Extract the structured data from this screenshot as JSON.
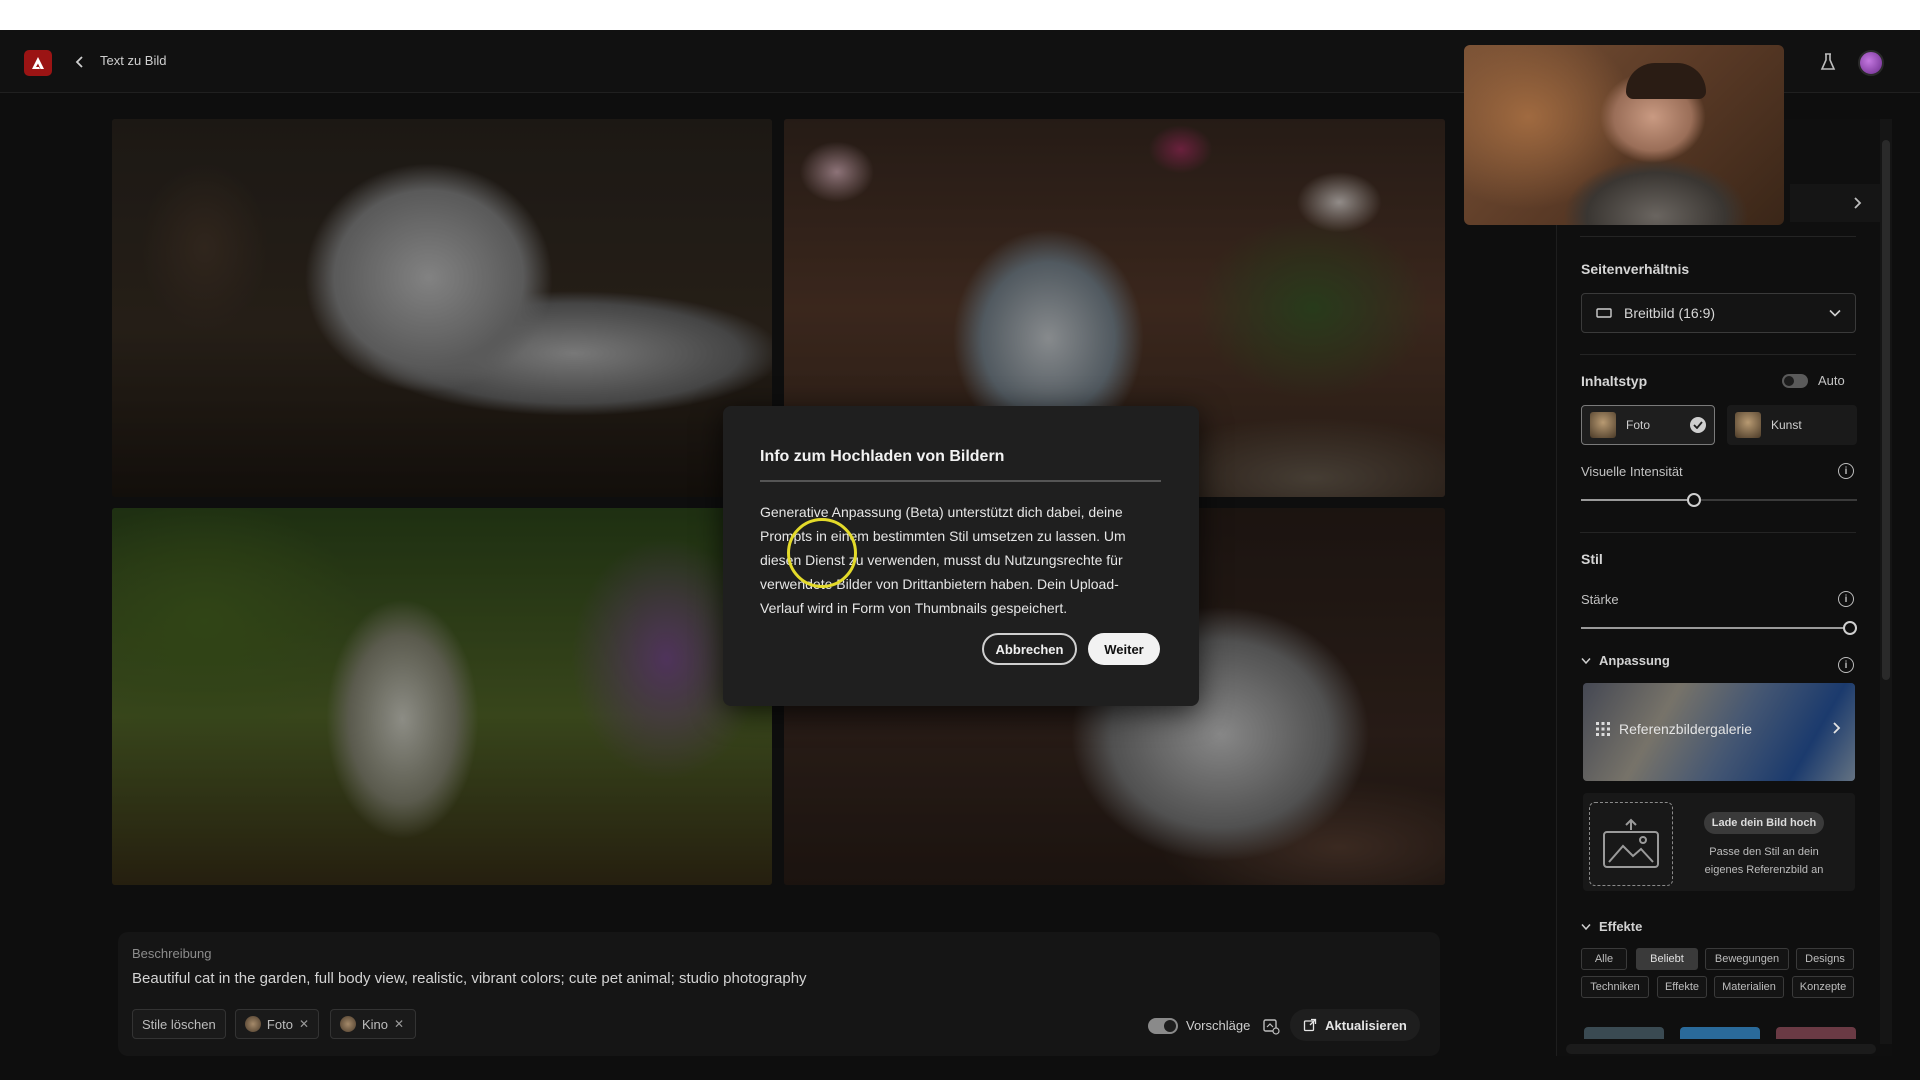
{
  "header": {
    "title": "Text zu Bild"
  },
  "dialog": {
    "title": "Info zum Hochladen von Bildern",
    "body": "Generative Anpassung (Beta) unterstützt dich dabei, deine Prompts in einem bestimmten Stil umsetzen zu lassen. Um diesen Dienst zu verwenden, musst du Nutzungsrechte für verwendete Bilder von Drittanbietern haben. Dein Upload-Verlauf wird in Form von Thumbnails gespeichert.",
    "cancel_label": "Abbrechen",
    "continue_label": "Weiter"
  },
  "prompt": {
    "label": "Beschreibung",
    "text": "Beautiful cat in the garden, full body view, realistic, vibrant colors; cute pet animal; studio photography",
    "clear_styles_label": "Stile löschen",
    "chips": [
      {
        "label": "Foto"
      },
      {
        "label": "Kino"
      }
    ],
    "suggestions_label": "Vorschläge",
    "update_label": "Aktualisieren"
  },
  "panel": {
    "aspect": {
      "heading": "Seitenverhältnis",
      "value": "Breitbild (16:9)"
    },
    "content_type": {
      "heading": "Inhaltstyp",
      "auto_label": "Auto",
      "options": [
        {
          "label": "Foto",
          "selected": true
        },
        {
          "label": "Kunst",
          "selected": false
        }
      ],
      "intensity_label": "Visuelle Intensität",
      "intensity_level": 0.41
    },
    "style": {
      "heading": "Stil",
      "strength_label": "Stärke",
      "strength_level": 1.0,
      "adaptation": {
        "heading": "Anpassung",
        "gallery_label": "Referenzbildergalerie",
        "upload_button": "Lade dein Bild hoch",
        "upload_desc": "Passe den Stil an dein eigenes Referenzbild an"
      }
    },
    "effects": {
      "heading": "Effekte",
      "tabs": [
        {
          "label": "Alle",
          "active": false
        },
        {
          "label": "Beliebt",
          "active": true
        },
        {
          "label": "Bewegungen",
          "active": false
        },
        {
          "label": "Designs",
          "active": false
        },
        {
          "label": "Techniken",
          "active": false
        },
        {
          "label": "Effekte",
          "active": false
        },
        {
          "label": "Materialien",
          "active": false
        },
        {
          "label": "Konzepte",
          "active": false
        }
      ]
    }
  },
  "colors": {
    "background": "#0e0e0e",
    "dialog": "#1f1f1f",
    "brand": "#9b1414",
    "cursor_highlight": "#e3da2a"
  },
  "icons": [
    "adobe-logo-icon",
    "back-chevron-icon",
    "flask-icon",
    "avatar",
    "chevron-right-icon",
    "widescreen-icon",
    "chevron-down-icon",
    "check-icon",
    "info-icon",
    "grid-icon",
    "image-upload-icon",
    "suggestions-icon",
    "refresh-icon",
    "close-icon"
  ]
}
